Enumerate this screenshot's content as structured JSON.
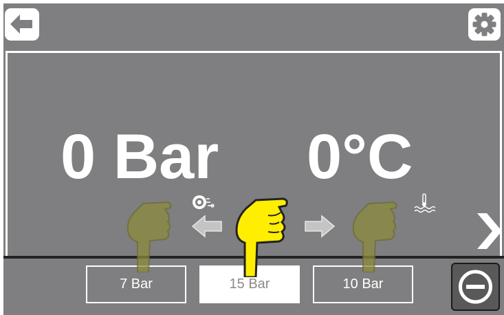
{
  "header": {
    "back_icon": "arrow-left-icon",
    "settings_icon": "gear-icon"
  },
  "readouts": {
    "pressure": "0 Bar",
    "temperature": "0°C",
    "pressure_icon": "compressor-air-icon",
    "temperature_icon": "water-temperature-icon"
  },
  "presets": [
    {
      "label": "7 Bar",
      "selected": false
    },
    {
      "label": "15 Bar",
      "selected": true
    },
    {
      "label": "10 Bar",
      "selected": false
    }
  ],
  "controls": {
    "next_icon": "chevron-right-icon",
    "stop_icon": "stop-minus-circle-icon",
    "left_arrow_icon": "arrow-left-icon",
    "right_arrow_icon": "arrow-right-icon",
    "hand_icon": "pointing-hand-icon"
  },
  "colors": {
    "background": "#7f7f81",
    "foreground": "#ffffff",
    "highlight_hand": "#ffee00",
    "dim_hand": "#8b8a3c"
  }
}
